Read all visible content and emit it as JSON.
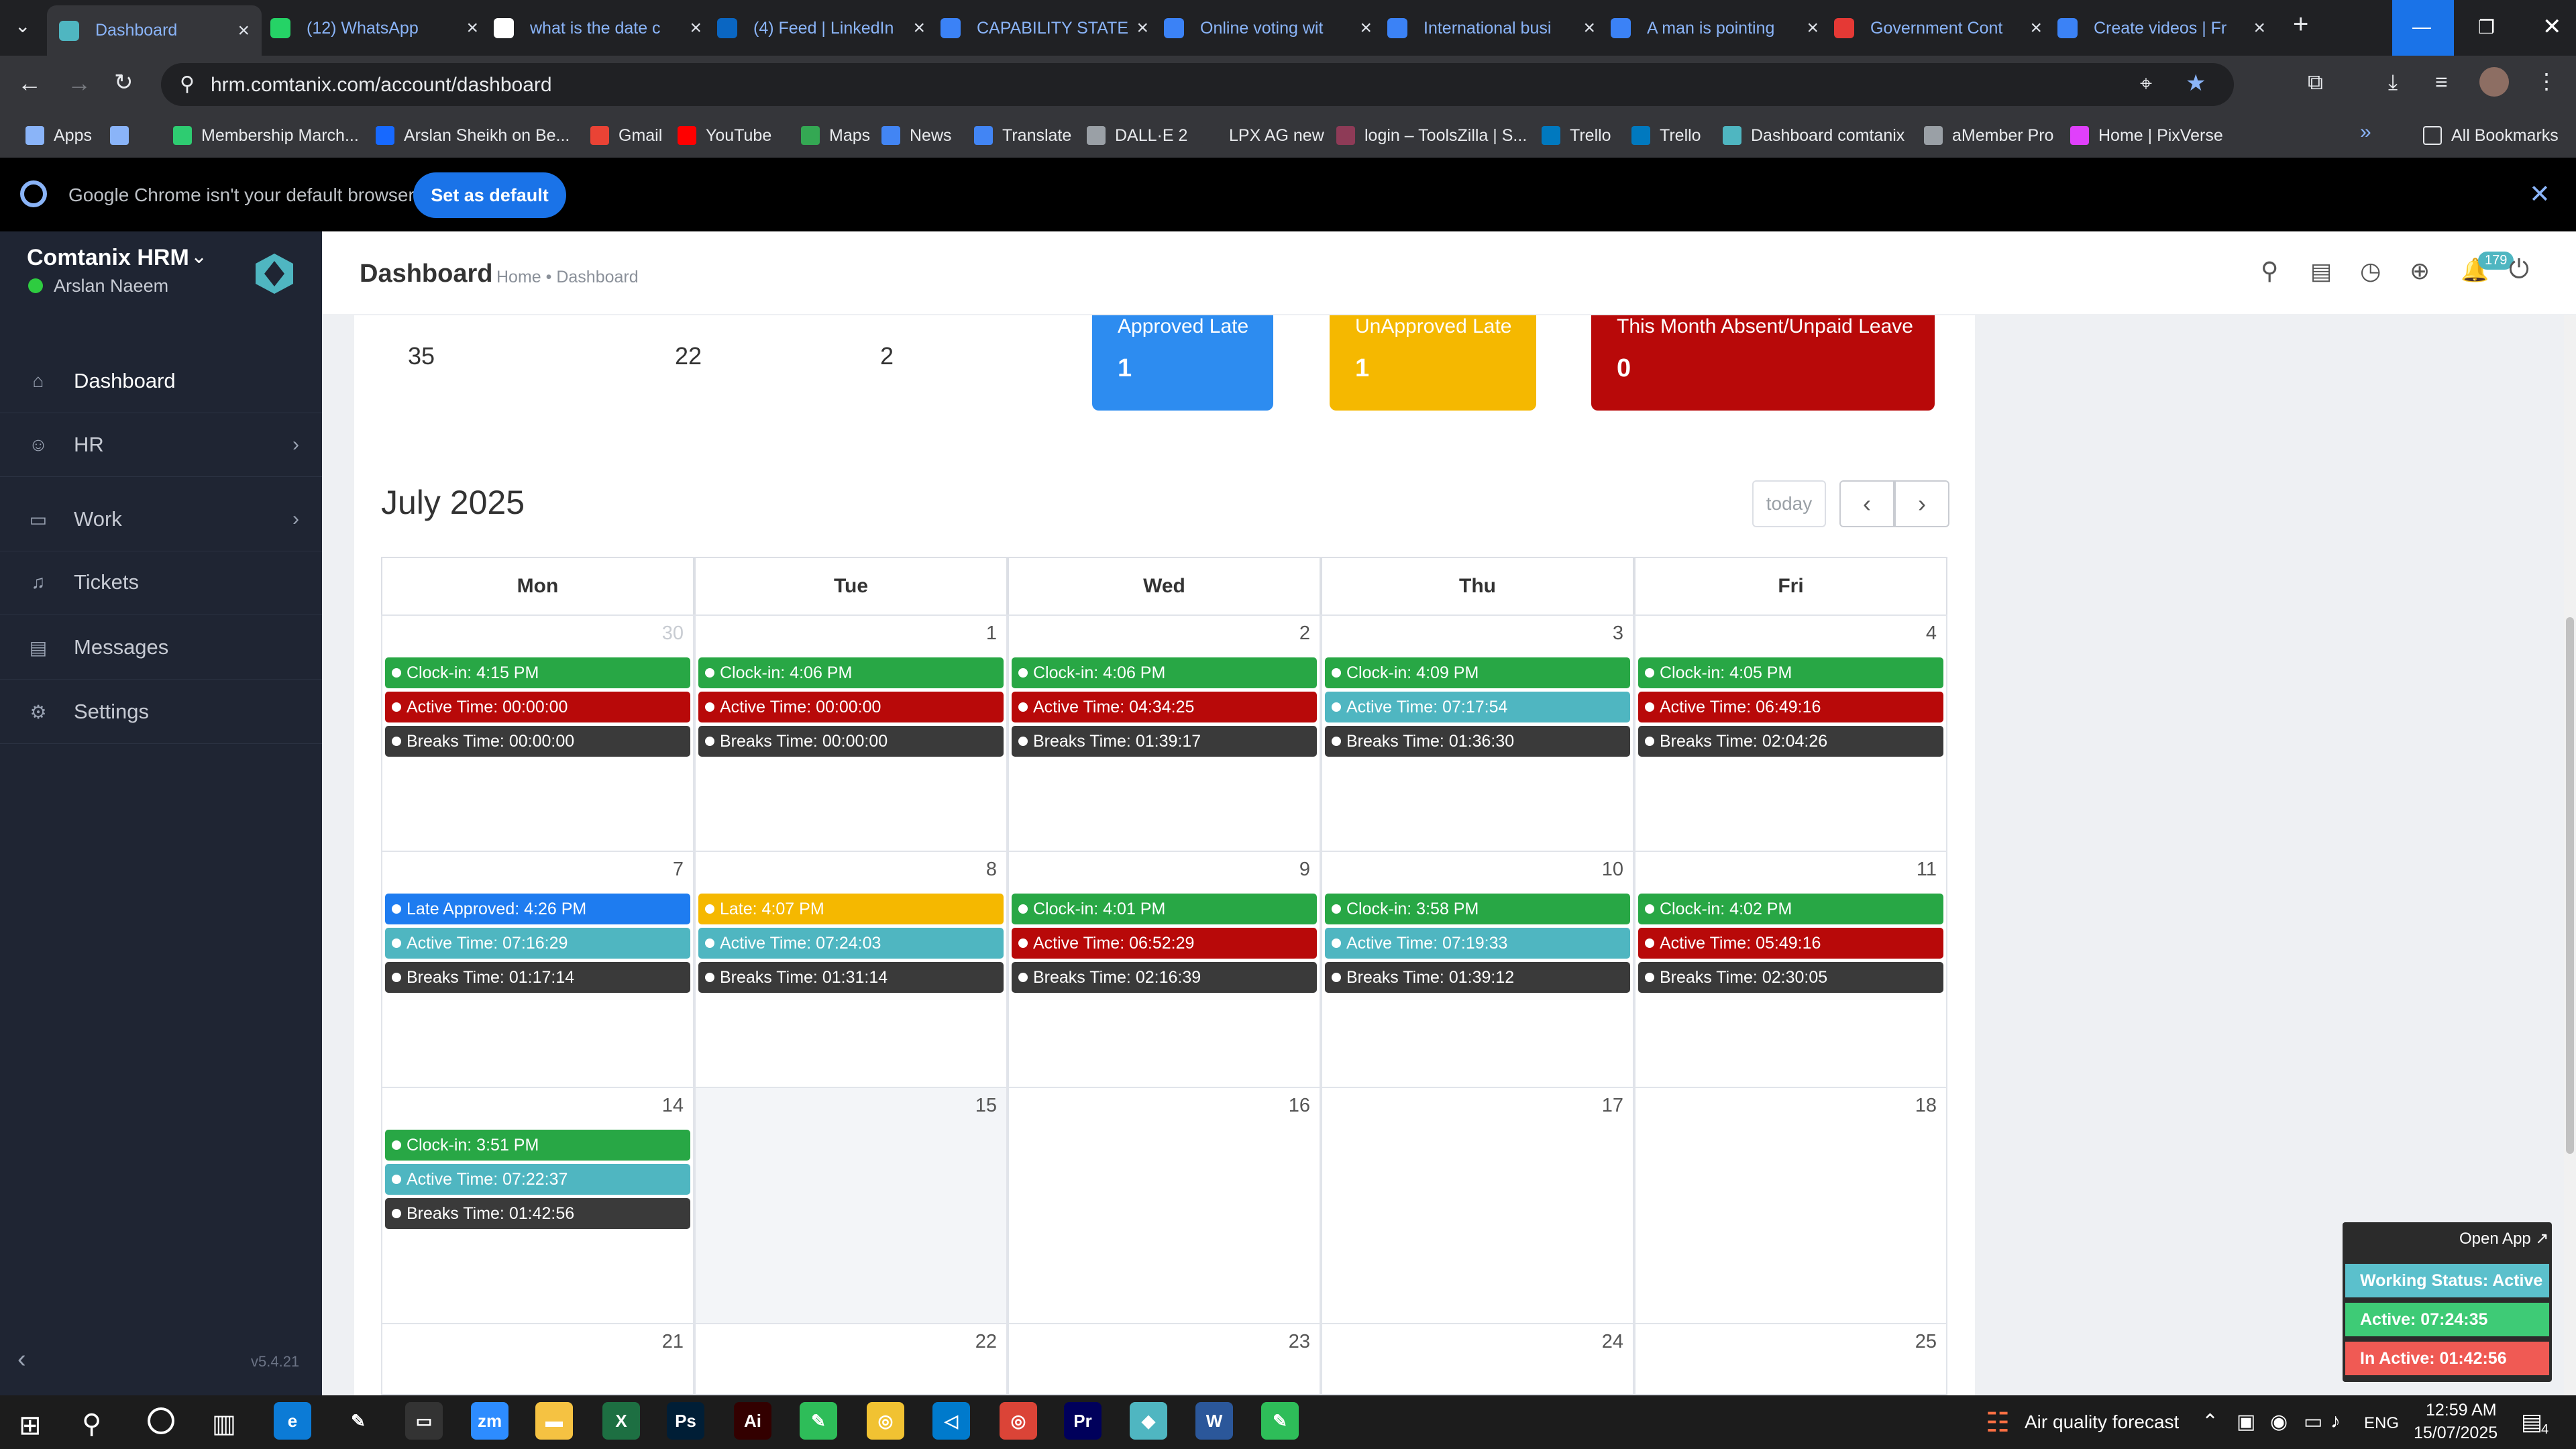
{
  "browser": {
    "tabs": [
      {
        "title": "Dashboard",
        "color": "#4fb6c1"
      },
      {
        "title": "(12) WhatsApp",
        "color": "#25d366"
      },
      {
        "title": "what is the date c",
        "color": "#ffffff"
      },
      {
        "title": "(4) Feed | LinkedIn",
        "color": "#0a66c2"
      },
      {
        "title": "CAPABILITY STATE",
        "color": "#3b82f6"
      },
      {
        "title": "Online voting wit",
        "color": "#3b82f6"
      },
      {
        "title": "International busi",
        "color": "#3b82f6"
      },
      {
        "title": "A man is pointing",
        "color": "#3b82f6"
      },
      {
        "title": "Government Cont",
        "color": "#e53935"
      },
      {
        "title": "Create videos | Fr",
        "color": "#3b82f6"
      }
    ],
    "url": "hrm.comtanix.com/account/dashboard",
    "bookmarks": [
      {
        "label": "Apps",
        "color": "#8ab4f8"
      },
      {
        "label": "",
        "color": "#8ab4f8"
      },
      {
        "label": "Membership March...",
        "color": "#2ecc71"
      },
      {
        "label": "Arslan Sheikh on Be...",
        "color": "#1769ff"
      },
      {
        "label": "Gmail",
        "color": "#ea4335"
      },
      {
        "label": "YouTube",
        "color": "#ff0000"
      },
      {
        "label": "Maps",
        "color": "#34a853"
      },
      {
        "label": "News",
        "color": "#4285f4"
      },
      {
        "label": "Translate",
        "color": "#4285f4"
      },
      {
        "label": "DALL·E 2",
        "color": "#9aa0a6"
      },
      {
        "label": "LPX AG new",
        "color": "#35363a"
      },
      {
        "label": "login – ToolsZilla | S...",
        "color": "#8e3b57"
      },
      {
        "label": "Trello",
        "color": "#0079bf"
      },
      {
        "label": "Trello",
        "color": "#0079bf"
      },
      {
        "label": "Dashboard comtanix",
        "color": "#4fb6c1"
      },
      {
        "label": "aMember Pro",
        "color": "#9aa0a6"
      },
      {
        "label": "Home | PixVerse",
        "color": "#e040fb"
      }
    ],
    "all_bookmarks": "All Bookmarks",
    "infobar": {
      "message": "Google Chrome isn't your default browser",
      "button": "Set as default"
    }
  },
  "app": {
    "brand": "Comtanix HRM",
    "user": "Arslan Naeem",
    "version": "v5.4.21",
    "nav": [
      {
        "label": "Dashboard",
        "icon": "home-icon",
        "chev": false
      },
      {
        "label": "HR",
        "icon": "users-icon",
        "chev": true
      },
      {
        "label": "Work",
        "icon": "briefcase-icon",
        "chev": true
      },
      {
        "label": "Tickets",
        "icon": "headset-icon",
        "chev": false
      },
      {
        "label": "Messages",
        "icon": "messages-icon",
        "chev": false
      },
      {
        "label": "Settings",
        "icon": "gear-icon",
        "chev": false
      }
    ],
    "page_title": "Dashboard",
    "breadcrumb": "Home • Dashboard",
    "notif_count": "179"
  },
  "stats": {
    "plain": [
      "35",
      "22",
      "2"
    ],
    "cards": [
      {
        "label": "Approved Late",
        "value": "1",
        "color": "#2d8cf0"
      },
      {
        "label": "UnApproved Late",
        "value": "1",
        "color": "#f5b800"
      },
      {
        "label": "This Month Absent/Unpaid Leave",
        "value": "0",
        "color": "#b80909"
      }
    ]
  },
  "calendar": {
    "title": "July 2025",
    "today_label": "today",
    "days": [
      "Mon",
      "Tue",
      "Wed",
      "Thu",
      "Fri"
    ],
    "weeks": [
      [
        {
          "n": "30",
          "dim": true,
          "ev": [
            [
              "green",
              "Clock-in: 4:15 PM"
            ],
            [
              "red",
              "Active Time: 00:00:00"
            ],
            [
              "dark",
              "Breaks Time: 00:00:00"
            ]
          ]
        },
        {
          "n": "1",
          "ev": [
            [
              "green",
              "Clock-in: 4:06 PM"
            ],
            [
              "red",
              "Active Time: 00:00:00"
            ],
            [
              "dark",
              "Breaks Time: 00:00:00"
            ]
          ]
        },
        {
          "n": "2",
          "ev": [
            [
              "green",
              "Clock-in: 4:06 PM"
            ],
            [
              "red",
              "Active Time: 04:34:25"
            ],
            [
              "dark",
              "Breaks Time: 01:39:17"
            ]
          ]
        },
        {
          "n": "3",
          "ev": [
            [
              "green",
              "Clock-in: 4:09 PM"
            ],
            [
              "teal",
              "Active Time: 07:17:54"
            ],
            [
              "dark",
              "Breaks Time: 01:36:30"
            ]
          ]
        },
        {
          "n": "4",
          "ev": [
            [
              "green",
              "Clock-in: 4:05 PM"
            ],
            [
              "red",
              "Active Time: 06:49:16"
            ],
            [
              "dark",
              "Breaks Time: 02:04:26"
            ]
          ]
        }
      ],
      [
        {
          "n": "7",
          "ev": [
            [
              "blue",
              "Late Approved: 4:26 PM"
            ],
            [
              "teal",
              "Active Time: 07:16:29"
            ],
            [
              "dark",
              "Breaks Time: 01:17:14"
            ]
          ]
        },
        {
          "n": "8",
          "ev": [
            [
              "yellow",
              "Late: 4:07 PM"
            ],
            [
              "teal",
              "Active Time: 07:24:03"
            ],
            [
              "dark",
              "Breaks Time: 01:31:14"
            ]
          ]
        },
        {
          "n": "9",
          "ev": [
            [
              "green",
              "Clock-in: 4:01 PM"
            ],
            [
              "red",
              "Active Time: 06:52:29"
            ],
            [
              "dark",
              "Breaks Time: 02:16:39"
            ]
          ]
        },
        {
          "n": "10",
          "ev": [
            [
              "green",
              "Clock-in: 3:58 PM"
            ],
            [
              "teal",
              "Active Time: 07:19:33"
            ],
            [
              "dark",
              "Breaks Time: 01:39:12"
            ]
          ]
        },
        {
          "n": "11",
          "ev": [
            [
              "green",
              "Clock-in: 4:02 PM"
            ],
            [
              "red",
              "Active Time: 05:49:16"
            ],
            [
              "dark",
              "Breaks Time: 02:30:05"
            ]
          ]
        }
      ],
      [
        {
          "n": "14",
          "ev": [
            [
              "green",
              "Clock-in: 3:51 PM"
            ],
            [
              "teal",
              "Active Time: 07:22:37"
            ],
            [
              "dark",
              "Breaks Time: 01:42:56"
            ]
          ]
        },
        {
          "n": "15",
          "today": true,
          "ev": []
        },
        {
          "n": "16",
          "ev": []
        },
        {
          "n": "17",
          "ev": []
        },
        {
          "n": "18",
          "ev": []
        }
      ],
      [
        {
          "n": "21",
          "ev": []
        },
        {
          "n": "22",
          "ev": []
        },
        {
          "n": "23",
          "ev": []
        },
        {
          "n": "24",
          "ev": []
        },
        {
          "n": "25",
          "ev": []
        }
      ]
    ]
  },
  "widget": {
    "open": "Open App ↗",
    "status": "Working Status: Active",
    "active": "Active: 07:24:35",
    "inactive": "In Active: 01:42:56"
  },
  "taskbar": {
    "weather": "Air quality forecast",
    "lang": "ENG",
    "time": "12:59 AM",
    "date": "15/07/2025",
    "notif": "4"
  }
}
